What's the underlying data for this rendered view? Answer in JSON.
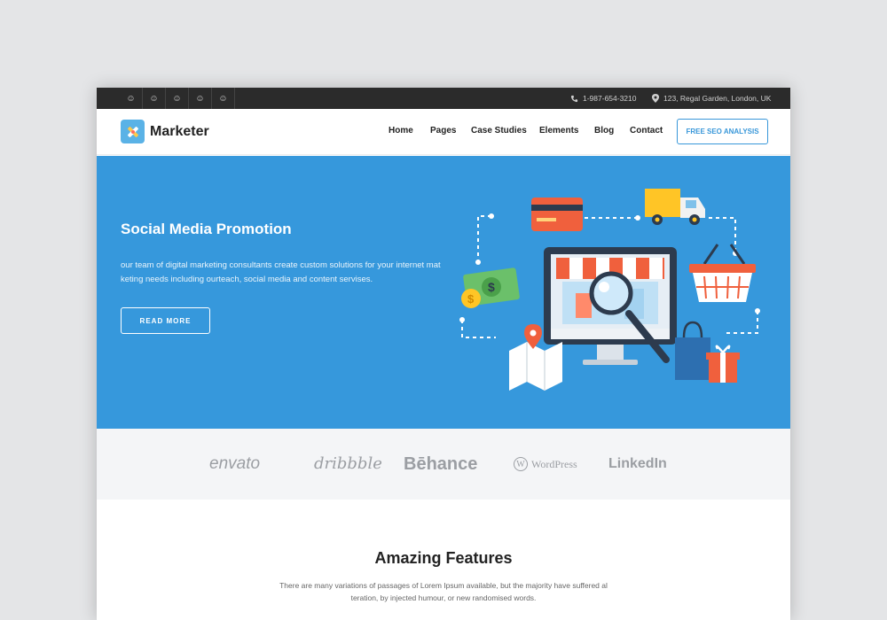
{
  "topbar": {
    "social_icons": [
      "social-icon-1",
      "social-icon-2",
      "social-icon-3",
      "social-icon-4",
      "social-icon-5"
    ],
    "phone": "1-987-654-3210",
    "address": "123, Regal Garden, London, UK"
  },
  "header": {
    "logo_text": "Marketer",
    "nav": [
      "Home",
      "Pages",
      "Case Studies",
      "Elements",
      "Blog",
      "Contact"
    ],
    "cta_label": "FREE SEO ANALYSIS"
  },
  "hero": {
    "title": "Social Media Promotion",
    "text": "our team of digital marketing consultants create custom solutions for your internet matketing needs including ourteach, social media and content servises.",
    "button_label": "READ MORE",
    "background": "#3698dc"
  },
  "brands": [
    "envato",
    "dribbble",
    "Bēhance",
    "WordPress",
    "LinkedIn"
  ],
  "features": {
    "title": "Amazing Features",
    "text": "There are many variations of passages of Lorem Ipsum available, but the majority have suffered alteration, by injected humour, or new randomised words."
  },
  "colors": {
    "accent": "#3897d9",
    "topbar": "#2b2b2b"
  }
}
